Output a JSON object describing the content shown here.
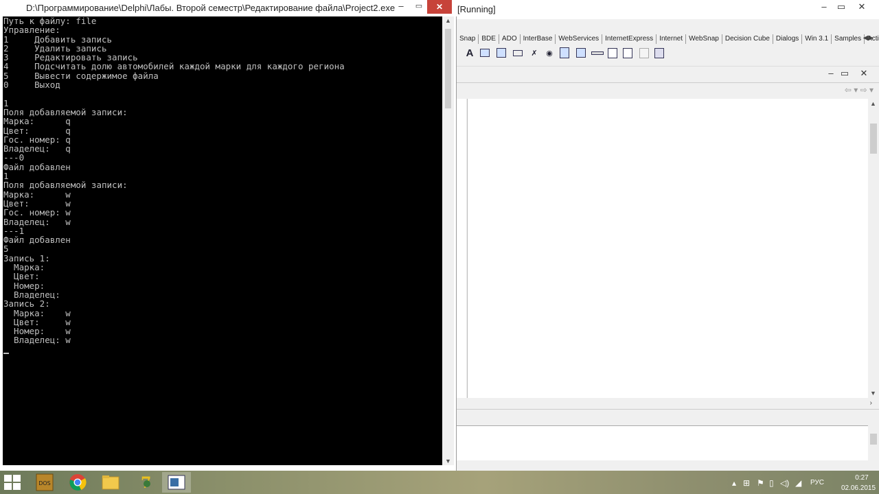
{
  "console": {
    "title": "D:\\Программирование\\Delphi\\Лабы. Второй семестр\\Редактирование файла\\Project2.exe",
    "lines": [
      "Путь к файлу: file",
      "Управление:",
      "1     Добавить запись",
      "2     Удалить запись",
      "3     Редактировать запись",
      "4     Подсчитать долю автомобилей каждой марки для каждого региона",
      "5     Вывести содержимое файла",
      "0     Выход",
      "",
      "1",
      "Поля добавляемой записи:",
      "Марка:      q",
      "Цвет:       q",
      "Гос. номер: q",
      "Владелец:   q",
      "---0",
      "Файл добавлен",
      "1",
      "Поля добавляемой записи:",
      "Марка:      w",
      "Цвет:       w",
      "Гос. номер: w",
      "Владелец:   w",
      "---1",
      "Файл добавлен",
      "5",
      "Запись 1:",
      "  Марка:",
      "  Цвет:",
      "  Номер:",
      "  Владелец:",
      "Запись 2:",
      "  Марка:    w",
      "  Цвет:     w",
      "  Номер:    w",
      "  Владелец: w"
    ],
    "window_controls": {
      "minimize": "–",
      "maximize": "▭",
      "close": "✕"
    }
  },
  "ide": {
    "title": "[Running]",
    "window_controls": {
      "minimize": "–",
      "maximize": "▭",
      "close": "✕"
    },
    "palette_tabs": [
      "Snap",
      "BDE",
      "ADO",
      "InterBase",
      "WebServices",
      "InternetExpress",
      "Internet",
      "WebSnap",
      "Decision Cube",
      "Dialogs",
      "Win 3.1",
      "Samples",
      "Activ"
    ],
    "palette_icons": [
      "label-icon",
      "edit-icon",
      "memo-icon",
      "button-icon",
      "checkbox-icon",
      "radiobutton-icon",
      "listbox-icon",
      "combobox-icon",
      "scrollbar-icon",
      "groupbox-icon",
      "radiogroup-icon",
      "panel-icon",
      "actionlist-icon"
    ],
    "label_glyph": "A",
    "checkbox_glyph": "✗",
    "radio_glyph": "◉",
    "nav_arrows": "⇦ ▾ ⇨ ▾"
  },
  "taskbar": {
    "apps": [
      "dosbox-icon",
      "chrome-icon",
      "file-explorer-icon",
      "delphi-icon",
      "console-app-icon"
    ],
    "tray": {
      "language": "РУС",
      "time": "0:27",
      "date": "02.06.2015"
    }
  }
}
